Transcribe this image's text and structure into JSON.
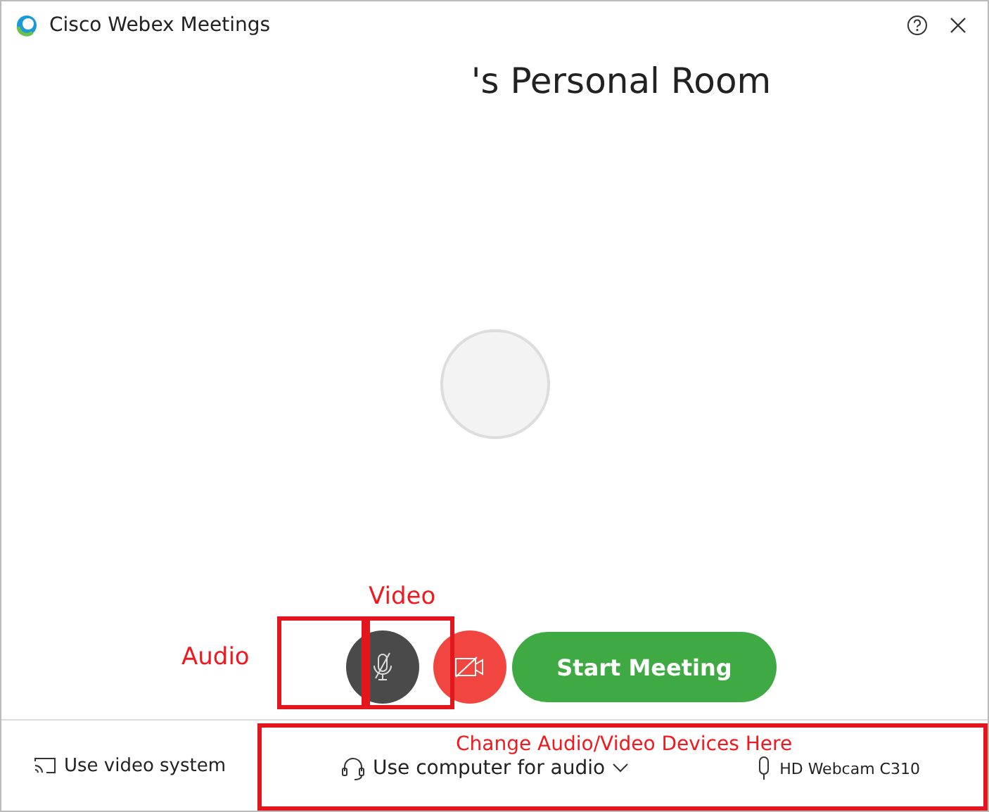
{
  "window": {
    "title": "Cisco Webex Meetings"
  },
  "room_title": "'s Personal Room",
  "controls": {
    "audio_muted": true,
    "video_off": true,
    "start_button": "Start Meeting"
  },
  "bottom_bar": {
    "video_system": "Use video system",
    "audio_device": "Use computer for audio",
    "camera": "HD Webcam C310"
  },
  "annotations": [
    {
      "kind": "label",
      "text": "Audio"
    },
    {
      "kind": "label",
      "text": "Video"
    },
    {
      "kind": "label",
      "text": "Change Audio/Video Devices Here"
    }
  ]
}
